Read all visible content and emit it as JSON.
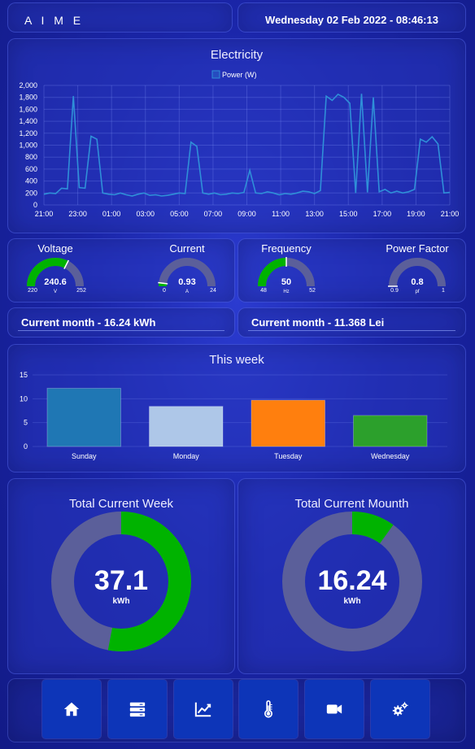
{
  "header": {
    "app_title": "A I M E",
    "datetime": "Wednesday 02 Feb 2022 - 08:46:13"
  },
  "electricity": {
    "title": "Electricity",
    "legend": "Power (W)",
    "series_color": "#2f8fd8"
  },
  "gauges": [
    {
      "label": "Voltage",
      "value": "240.6",
      "min": "220",
      "max": "252",
      "unit": "V",
      "fraction": 0.65,
      "color": "#00b300"
    },
    {
      "label": "Current",
      "value": "0.93",
      "min": "0",
      "max": "24",
      "unit": "A",
      "fraction": 0.04,
      "color": "#00b300"
    },
    {
      "label": "Frequency",
      "value": "50",
      "min": "48",
      "max": "52",
      "unit": "Hz",
      "fraction": 0.5,
      "color": "#00b300"
    },
    {
      "label": "Power Factor",
      "value": "0.8",
      "min": "0.9",
      "max": "1",
      "unit": "pf",
      "fraction": 0.0,
      "color": "#00b300"
    }
  ],
  "month": {
    "kwh_text": "Current month - 16.24 kWh",
    "lei_text": "Current month - 11.368 Lei"
  },
  "week": {
    "title": "This week"
  },
  "totals": {
    "week_title": "Total Current Week",
    "week_value": "37.1",
    "week_unit": "kWh",
    "week_fraction": 0.53,
    "month_title": "Total Current Mounth",
    "month_value": "16.24",
    "month_unit": "kWh",
    "month_fraction": 0.1,
    "accent": "#00b300",
    "track": "#5b5f9a"
  },
  "nav": [
    {
      "name": "home",
      "icon": "home-icon"
    },
    {
      "name": "servers",
      "icon": "server-icon"
    },
    {
      "name": "chart",
      "icon": "chart-line-icon"
    },
    {
      "name": "temperature",
      "icon": "thermometer-icon"
    },
    {
      "name": "camera",
      "icon": "video-camera-icon"
    },
    {
      "name": "settings",
      "icon": "gears-icon"
    }
  ],
  "chart_data": [
    {
      "type": "line",
      "title": "Electricity",
      "series": [
        {
          "name": "Power (W)",
          "values": [
            180,
            200,
            190,
            280,
            270,
            1820,
            290,
            280,
            1150,
            1100,
            200,
            180,
            170,
            200,
            170,
            150,
            180,
            200,
            160,
            170,
            150,
            160,
            180,
            200,
            190,
            1050,
            980,
            200,
            180,
            200,
            170,
            180,
            200,
            190,
            210,
            580,
            200,
            190,
            220,
            200,
            170,
            190,
            180,
            200,
            230,
            220,
            190,
            240,
            1820,
            1750,
            1850,
            1800,
            1700,
            200,
            1860,
            210,
            1800,
            220,
            260,
            200,
            230,
            200,
            220,
            260,
            1100,
            1050,
            1140,
            1020,
            200,
            210
          ]
        }
      ],
      "x_ticks": [
        "21:00",
        "23:00",
        "01:00",
        "03:00",
        "05:00",
        "07:00",
        "09:00",
        "11:00",
        "13:00",
        "15:00",
        "17:00",
        "19:00",
        "21:00"
      ],
      "y_ticks": [
        "0",
        "200",
        "400",
        "600",
        "800",
        "1,000",
        "1,200",
        "1,400",
        "1,600",
        "1,800",
        "2,000"
      ],
      "ylim": [
        0,
        2000
      ]
    },
    {
      "type": "bar",
      "title": "This week",
      "categories": [
        "Sunday",
        "Monday",
        "Tuesday",
        "Wednesday"
      ],
      "values": [
        12.2,
        8.4,
        9.7,
        6.5
      ],
      "colors": [
        "#1f77b4",
        "#aec7e8",
        "#ff7f0e",
        "#2ca02c"
      ],
      "y_ticks": [
        "0",
        "5",
        "10",
        "15"
      ],
      "ylim": [
        0,
        15
      ]
    }
  ]
}
